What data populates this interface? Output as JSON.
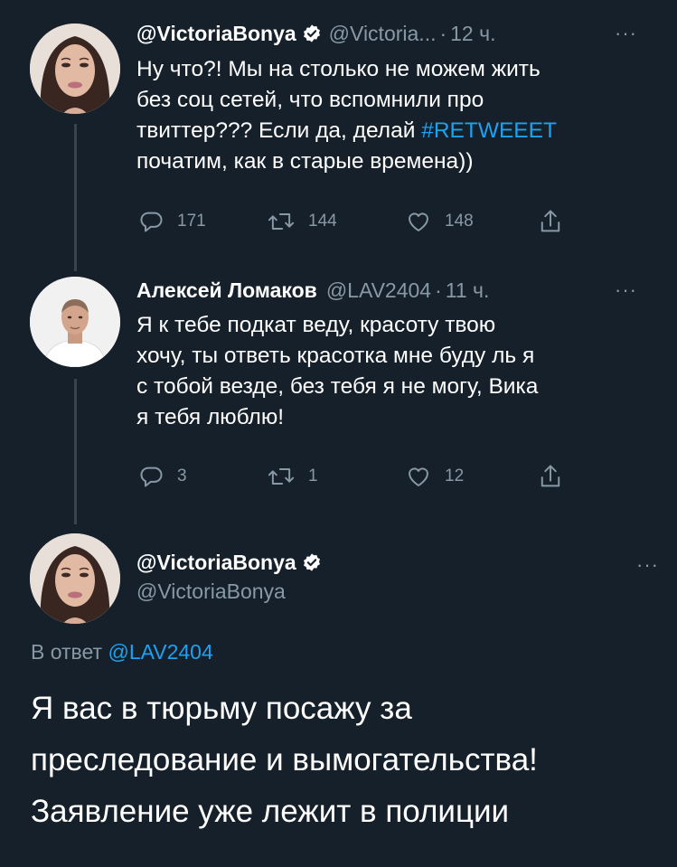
{
  "tweet1": {
    "name": "@VictoriaBonya",
    "handle": "@Victoria...",
    "separator": "·",
    "time": "12 ч.",
    "more": "···",
    "text_lines": [
      "Ну что?! Мы на столько не можем жить",
      "без соц сетей, что вспомнили про",
      "твиттер??? Если да, делай ",
      "початим, как в старые времена))"
    ],
    "hashtag": "#RETWEEET",
    "replies": "171",
    "retweets": "144",
    "likes": "148"
  },
  "tweet2": {
    "name": "Алексей Ломаков",
    "handle": "@LAV2404",
    "separator": "·",
    "time": "11 ч.",
    "more": "···",
    "text_lines": [
      "Я к тебе подкат веду, красоту твою",
      "хочу, ты ответь красотка мне буду ль я",
      "с тобой везде, без тебя я не могу, Вика",
      "я тебя люблю!"
    ],
    "replies": "3",
    "retweets": "1",
    "likes": "12"
  },
  "tweet3": {
    "name": "@VictoriaBonya",
    "handle": "@VictoriaBonya",
    "more": "···",
    "reply_prefix": "В ответ ",
    "reply_handle": "@LAV2404",
    "text_lines": [
      "Я вас в тюрьму посажу за",
      "преследование и вымогательства!",
      "Заявление уже лежит в полиции"
    ]
  },
  "colors": {
    "background": "#15202b",
    "accent": "#1da1f2",
    "secondary_text": "#8899a6",
    "thread_line": "#38444d"
  },
  "icons": [
    "verified-badge-icon",
    "reply-icon",
    "retweet-icon",
    "like-icon",
    "share-icon",
    "more-icon"
  ]
}
